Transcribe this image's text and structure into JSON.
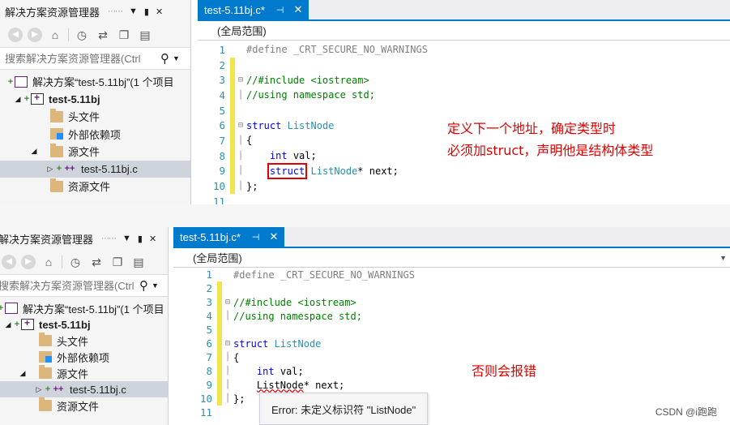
{
  "top": {
    "explorer": {
      "title": "解决方案资源管理器",
      "search_placeholder": "搜索解决方案资源管理器(Ctrl",
      "solution_label": "解决方案“test-5.11bj”(1 个项目",
      "project_label": "test-5.11bj",
      "items": [
        {
          "label": "头文件"
        },
        {
          "label": "外部依赖项"
        },
        {
          "label": "源文件"
        },
        {
          "label": "test-5.11bj.c"
        },
        {
          "label": "资源文件"
        }
      ]
    },
    "editor": {
      "tab_label": "test-5.11bj.c*",
      "scope": "(全局范围)",
      "line_numbers": [
        "1",
        "2",
        "3",
        "4",
        "5",
        "6",
        "7",
        "8",
        "9",
        "10",
        "11"
      ]
    },
    "note_line1": "定义下一个地址，确定类型时",
    "note_line2": "必须加struct，声明他是结构体类型"
  },
  "bottom": {
    "explorer": {
      "title": "解决方案资源管理器",
      "search_placeholder": "搜索解决方案资源管理器(Ctrl",
      "solution_label": "解决方案“test-5.11bj”(1 个项目",
      "project_label": "test-5.11bj",
      "items": [
        {
          "label": "头文件"
        },
        {
          "label": "外部依赖项"
        },
        {
          "label": "源文件"
        },
        {
          "label": "test-5.11bj.c"
        },
        {
          "label": "资源文件"
        }
      ]
    },
    "editor": {
      "tab_label": "test-5.11bj.c*",
      "scope": "(全局范围)",
      "line_numbers": [
        "1",
        "2",
        "3",
        "4",
        "5",
        "6",
        "7",
        "8",
        "9",
        "10",
        "11"
      ]
    },
    "note": "否则会报错",
    "tooltip": "Error: 未定义标识符 \"ListNode\""
  },
  "code": {
    "define": "#define _CRT_SECURE_NO_WARNINGS",
    "include": "//#include <iostream>",
    "using": "//using namespace std;",
    "struct_kw": "struct",
    "struct_name": "ListNode",
    "open_brace": "{",
    "int_kw": "int",
    "val_decl": " val;",
    "next_ptr": "* next;",
    "close": "};"
  },
  "watermark": "CSDN @i跑跑"
}
